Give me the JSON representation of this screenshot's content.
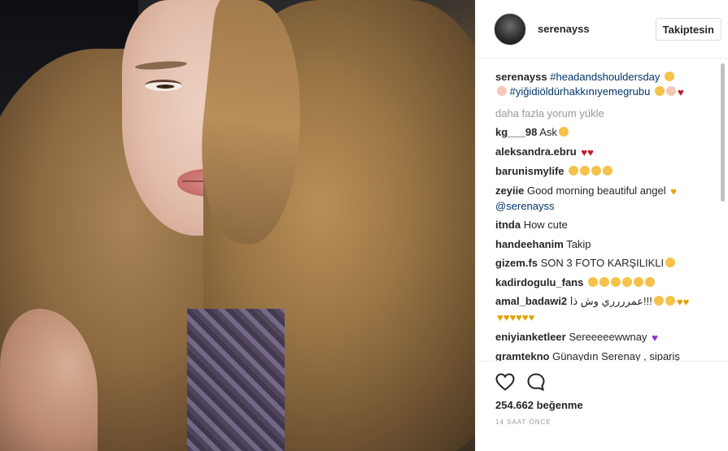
{
  "post": {
    "username": "serenayss",
    "follow_label": "Takiptesin",
    "caption": {
      "username": "serenayss",
      "hashtag1": "#headandshouldersday",
      "hashtag2": "#yiğidiöldürhakkınıyemegrubu"
    },
    "load_more": "daha fazla yorum yükle",
    "comments": [
      {
        "user": "kg___98",
        "text": "Ask"
      },
      {
        "user": "aleksandra.ebru",
        "text": ""
      },
      {
        "user": "barunismylife",
        "text": ""
      },
      {
        "user": "zeyiie",
        "text": "Good morning beautiful angel"
      },
      {
        "user": "",
        "text": "@serenayss"
      },
      {
        "user": "itnda",
        "text": "How cute"
      },
      {
        "user": "handeehanim",
        "text": "Takip"
      },
      {
        "user": "gizem.fs",
        "text": "SON 3 FOTO KARŞILIKLI"
      },
      {
        "user": "kadirdogulu_fans",
        "text": ""
      },
      {
        "user": "amal_badawi2",
        "text": "عمرررري وش ذا!!!"
      },
      {
        "user": "eniyianketleer",
        "text": "Sereeeeewwnay"
      },
      {
        "user": "gramtekno",
        "text": "Günaydın Serenay , sipariş"
      }
    ],
    "likes": "254.662 beğenme",
    "timestamp": "14 SAAT ÖNCE"
  },
  "icons": {
    "like": "heart-outline-icon",
    "comment": "speech-bubble-icon"
  },
  "colors": {
    "hashtag": "#003569",
    "muted": "#999999",
    "text": "#262626"
  }
}
